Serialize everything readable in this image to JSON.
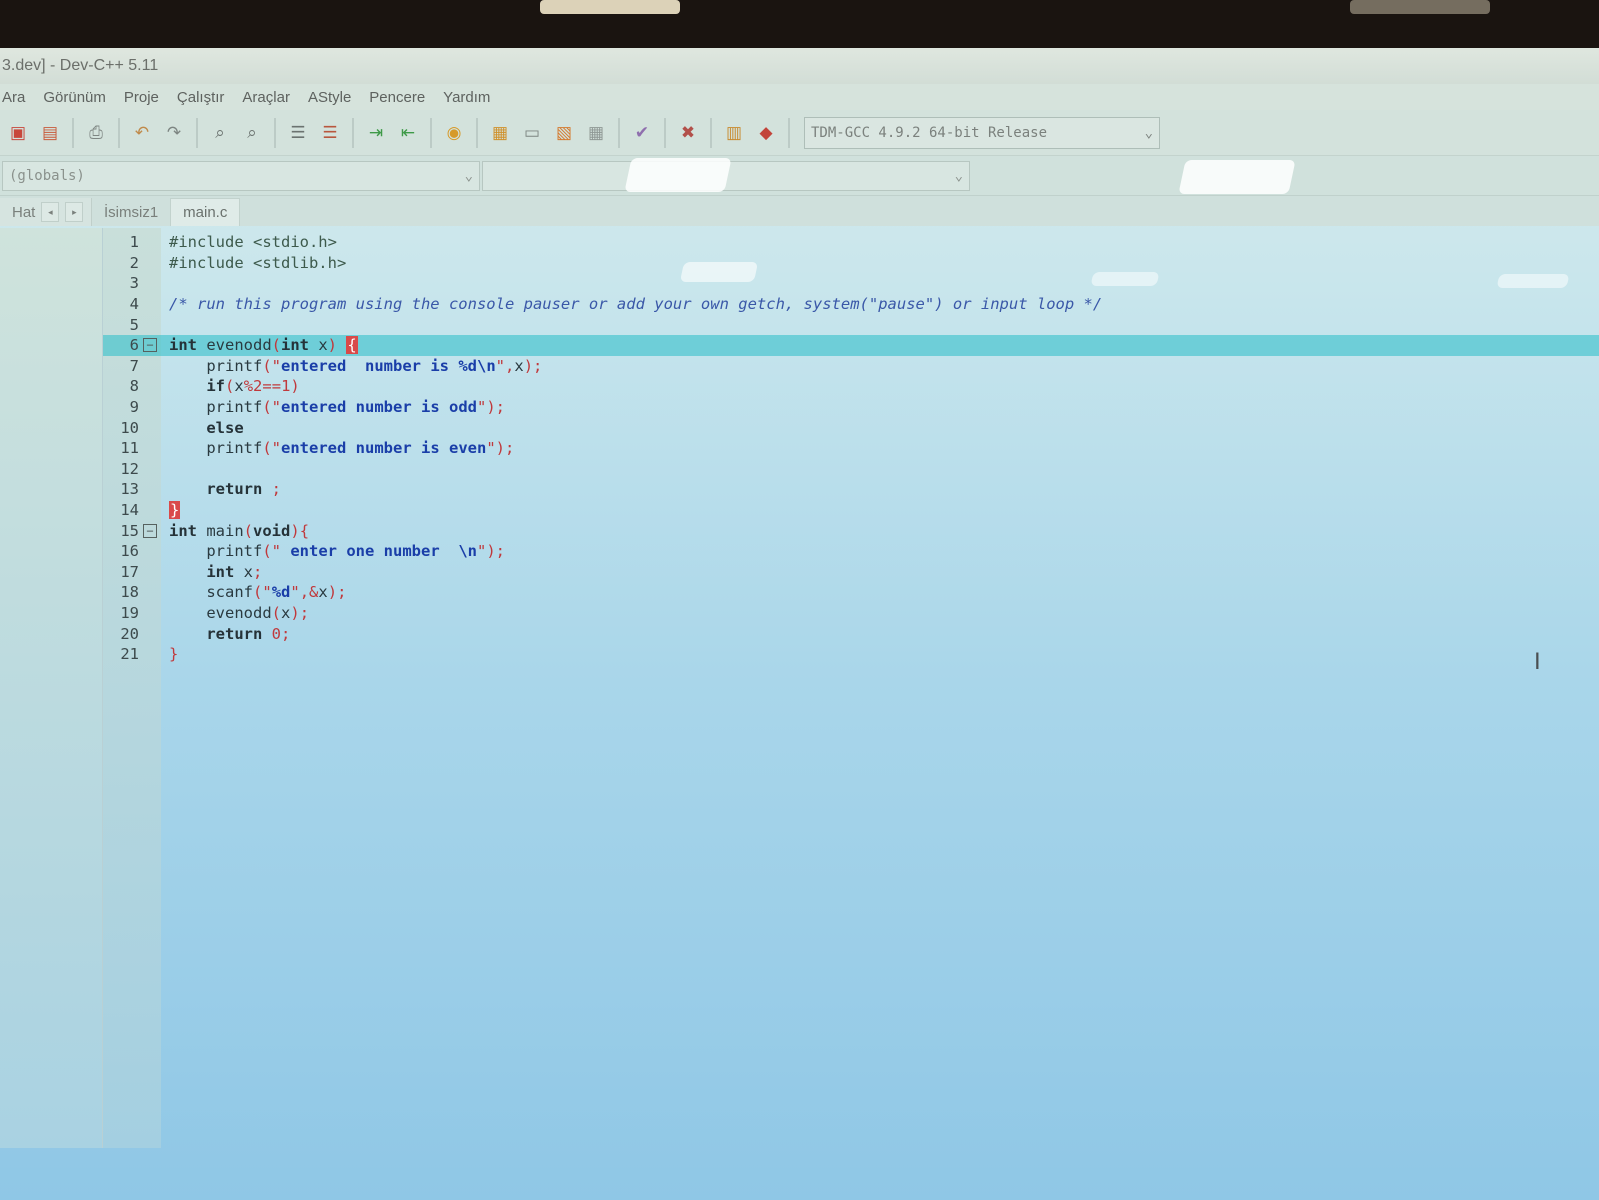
{
  "window": {
    "title": "3.dev] - Dev-C++ 5.11"
  },
  "menu": [
    "Ara",
    "Görünüm",
    "Proje",
    "Çalıştır",
    "Araçlar",
    "AStyle",
    "Pencere",
    "Yardım"
  ],
  "toolbar": {
    "icons": [
      "new-project-icon",
      "open-project-icon",
      "print-icon",
      "undo-icon",
      "redo-icon",
      "find-icon",
      "replace-icon",
      "indent-icon",
      "unindent-icon",
      "goto-icon",
      "bookmark-icon",
      "debug-icon",
      "grid-icon",
      "window-icon",
      "layout-icon",
      "tiles-icon",
      "check-icon",
      "stop-icon",
      "chart-icon",
      "profile-icon"
    ],
    "compiler": "TDM-GCC 4.9.2 64-bit Release"
  },
  "scope": {
    "globals": "(globals)",
    "second": ""
  },
  "tabs": {
    "side_label": "Hat",
    "files": [
      "İsimsiz1",
      "main.c"
    ],
    "active_index": 1
  },
  "code_lines": [
    "#include <stdio.h>",
    "#include <stdlib.h>",
    "",
    "/* run this program using the console pauser or add your own getch, system(\"pause\") or input loop */",
    "",
    "int evenodd(int x) {",
    "    printf(\"entered  number is %d\\n\",x);",
    "    if(x%2==1)",
    "    printf(\"entered number is odd\");",
    "    else",
    "    printf(\"entered number is even\");",
    "",
    "    return ;",
    "}",
    "int main(void){",
    "    printf(\" enter one number  \\n\");",
    "    int x;",
    "    scanf(\"%d\",&x);",
    "    evenodd(x);",
    "    return 0;",
    "}"
  ],
  "editor": {
    "current_line": 6
  },
  "colors": {
    "current_line": "#28bec8",
    "brace_match": "#d94a4a",
    "string": "#1a3ea8",
    "comment": "#3a58a8"
  }
}
